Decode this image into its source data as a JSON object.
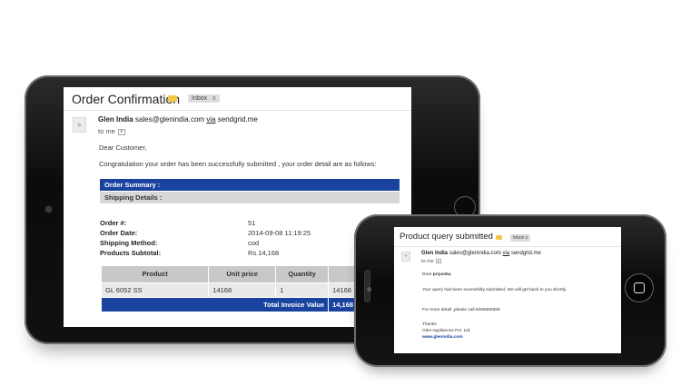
{
  "tablet_email": {
    "subject": "Order Confirmation",
    "label": "Inbox",
    "label_close": "x",
    "sender_name": "Glen India",
    "sender_email": "sales@glenindia.com",
    "via_word": "via",
    "via_domain": "sendgrid.me",
    "to_me": "to me",
    "greeting": "Dear Customer,",
    "intro": "Congratulation your order has been successfully submitted , your order detail are as follows:",
    "order_summary_heading": "Order Summary :",
    "shipping_heading": "Shipping Details :",
    "details": [
      {
        "label": "Order #:",
        "value": "51"
      },
      {
        "label": "Order Date:",
        "value": "2014-09-08 11:19:25"
      },
      {
        "label": "Shipping Method:",
        "value": "cod"
      },
      {
        "label": "Products Subtotal:",
        "value": "Rs.14,168"
      }
    ],
    "table": {
      "headers": [
        "Product",
        "Unit price",
        "Quantity",
        "Total"
      ],
      "rows": [
        [
          "GL 6052 SS",
          "14168",
          "1",
          "14168"
        ]
      ],
      "total_label": "Total Invoice Value",
      "total_value": "14,168"
    }
  },
  "phone_email": {
    "subject": "Product query submitted",
    "label": "Inbox",
    "label_close": "x",
    "sender_name": "Glen India",
    "sender_email": "sales@glenindia.com",
    "via_word": "via",
    "via_domain": "sendgrid.me",
    "to_me": "to me",
    "greeting_prefix": "Dear ",
    "greeting_name": "priyanka",
    "greeting_suffix": ",",
    "body_line": "Your query has been sucessfully submitted. We will get back to you shortly.",
    "more_detail": "For more detail ,please call 8266655555",
    "thanks": "Thanks",
    "company": "Glen Appliances Pvt. Ltd.",
    "website": "www.glenindia.com"
  },
  "colors": {
    "accent_blue": "#1a43a0",
    "label_yellow": "#f2c744"
  }
}
